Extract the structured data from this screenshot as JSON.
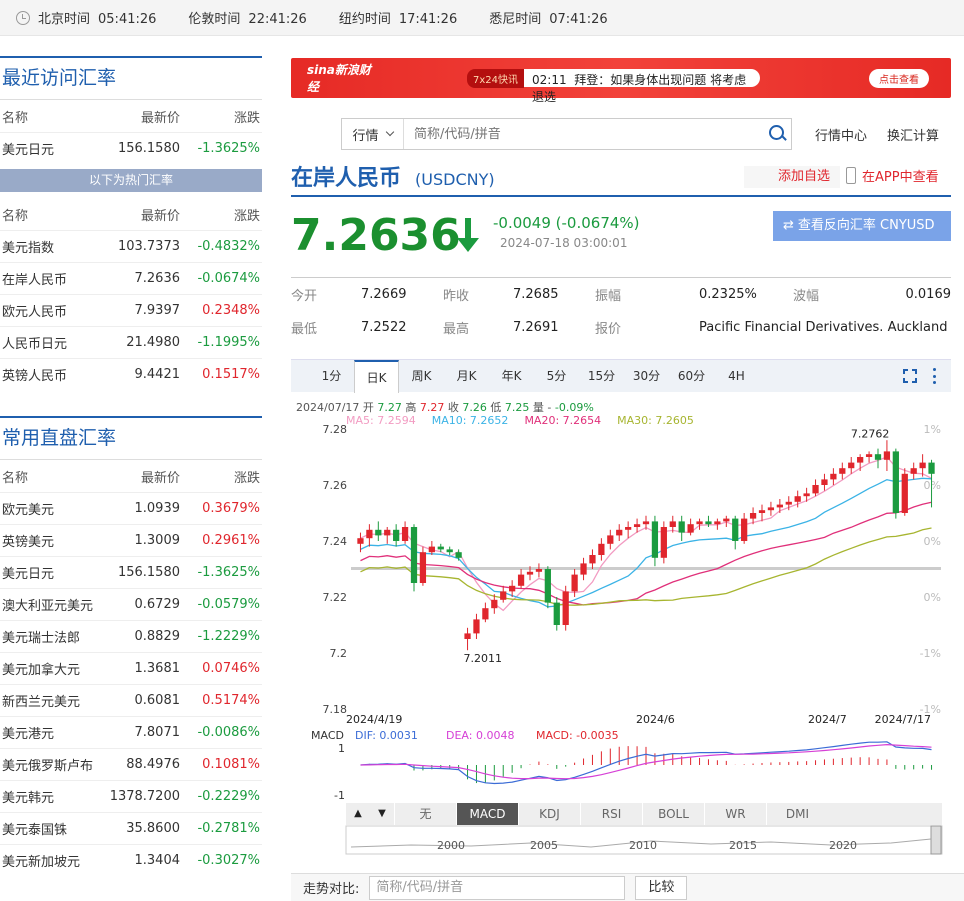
{
  "topbar": {
    "zones": [
      {
        "city": "北京时间",
        "time": "05:41:26"
      },
      {
        "city": "伦敦时间",
        "time": "22:41:26"
      },
      {
        "city": "纽约时间",
        "time": "17:41:26"
      },
      {
        "city": "悉尼时间",
        "time": "07:41:26"
      }
    ]
  },
  "recent": {
    "title": "最近访问汇率",
    "headers": [
      "名称",
      "最新价",
      "涨跌"
    ],
    "rows": [
      {
        "name": "美元日元",
        "price": "156.1580",
        "chg": "-1.3625%",
        "dir": "dn"
      }
    ],
    "hot_label": "以下为热门汇率",
    "hot_rows": [
      {
        "name": "美元指数",
        "price": "103.7373",
        "chg": "-0.4832%",
        "dir": "dn"
      },
      {
        "name": "在岸人民币",
        "price": "7.2636",
        "chg": "-0.0674%",
        "dir": "dn"
      },
      {
        "name": "欧元人民币",
        "price": "7.9397",
        "chg": "0.2348%",
        "dir": "up"
      },
      {
        "name": "人民币日元",
        "price": "21.4980",
        "chg": "-1.1995%",
        "dir": "dn"
      },
      {
        "name": "英镑人民币",
        "price": "9.4421",
        "chg": "0.1517%",
        "dir": "up"
      }
    ]
  },
  "common": {
    "title": "常用直盘汇率",
    "headers": [
      "名称",
      "最新价",
      "涨跌"
    ],
    "rows": [
      {
        "name": "欧元美元",
        "price": "1.0939",
        "chg": "0.3679%",
        "dir": "up"
      },
      {
        "name": "英镑美元",
        "price": "1.3009",
        "chg": "0.2961%",
        "dir": "up"
      },
      {
        "name": "美元日元",
        "price": "156.1580",
        "chg": "-1.3625%",
        "dir": "dn"
      },
      {
        "name": "澳大利亚元美元",
        "price": "0.6729",
        "chg": "-0.0579%",
        "dir": "dn"
      },
      {
        "name": "美元瑞士法郎",
        "price": "0.8829",
        "chg": "-1.2229%",
        "dir": "dn"
      },
      {
        "name": "美元加拿大元",
        "price": "1.3681",
        "chg": "0.0746%",
        "dir": "up"
      },
      {
        "name": "新西兰元美元",
        "price": "0.6081",
        "chg": "0.5174%",
        "dir": "up"
      },
      {
        "name": "美元港元",
        "price": "7.8071",
        "chg": "-0.0086%",
        "dir": "dn"
      },
      {
        "name": "美元俄罗斯卢布",
        "price": "88.4976",
        "chg": "0.1081%",
        "dir": "up"
      },
      {
        "name": "美元韩元",
        "price": "1378.7200",
        "chg": "-0.2229%",
        "dir": "dn"
      },
      {
        "name": "美元泰国铢",
        "price": "35.8600",
        "chg": "-0.2781%",
        "dir": "dn"
      },
      {
        "name": "美元新加坡元",
        "price": "1.3404",
        "chg": "-0.3027%",
        "dir": "dn"
      }
    ]
  },
  "banner": {
    "logo": "sina新浪财经",
    "tag": "7x24快讯",
    "time": "02:11",
    "text": "拜登：如果身体出现问题 将考虑退选",
    "button": "点击查看"
  },
  "search": {
    "select": "行情",
    "placeholder": "简称/代码/拼音"
  },
  "links": {
    "market": "行情中心",
    "calc": "换汇计算"
  },
  "header": {
    "title": "在岸人民币",
    "code": "(USDCNY)",
    "add_fav": "添加自选",
    "app_view": "在APP中查看",
    "price": "7.2636",
    "change": "-0.0049 (-0.0674%)",
    "time": "2024-07-18 03:00:01",
    "reverse_btn": "查看反向汇率 CNYUSD"
  },
  "stats": {
    "row1": [
      {
        "k": "今开",
        "v": "7.2669"
      },
      {
        "k": "昨收",
        "v": "7.2685"
      },
      {
        "k": "振幅",
        "v": "0.2325%"
      },
      {
        "k": "波幅",
        "v": "0.0169"
      }
    ],
    "row2": [
      {
        "k": "最低",
        "v": "7.2522"
      },
      {
        "k": "最高",
        "v": "7.2691"
      },
      {
        "k": "报价",
        "v": "Pacific Financial Derivatives. Auckland"
      }
    ]
  },
  "chart_tabs": [
    "1分",
    "日K",
    "周K",
    "月K",
    "年K",
    "5分",
    "15分",
    "30分",
    "60分",
    "4H"
  ],
  "chart_tab_active": "日K",
  "chart_info": {
    "ohlc": [
      {
        "t": "2024/07/17 开 ",
        "c": "#555"
      },
      {
        "t": "7.27",
        "c": "#1b9b3f"
      },
      {
        "t": " 高 ",
        "c": "#555"
      },
      {
        "t": "7.27",
        "c": "#e0262d"
      },
      {
        "t": " 收 ",
        "c": "#555"
      },
      {
        "t": "7.26",
        "c": "#1b9b3f"
      },
      {
        "t": " 低 ",
        "c": "#555"
      },
      {
        "t": "7.25",
        "c": "#1b9b3f"
      },
      {
        "t": " 量 - ",
        "c": "#555"
      },
      {
        "t": "-0.09%",
        "c": "#1b9b3f"
      }
    ],
    "ma": [
      {
        "t": "MA5: 7.2594",
        "c": "#f29bc2"
      },
      {
        "t": "MA10: 7.2652",
        "c": "#3bb3e6"
      },
      {
        "t": "MA20: 7.2654",
        "c": "#e0307a"
      },
      {
        "t": "MA30: 7.2605",
        "c": "#a7b530"
      }
    ]
  },
  "chart_data": {
    "type": "candlestick",
    "y_ticks": [
      "7.28",
      "7.26",
      "7.24",
      "7.22",
      "7.2",
      "7.18"
    ],
    "y_ticks_right": [
      "1%",
      "0%",
      "0%",
      "0%",
      "-1%",
      "-1%"
    ],
    "x_labels": [
      "2024/4/19",
      "2024/6",
      "2024/7",
      "2024/7/17"
    ],
    "ylim": [
      7.18,
      7.28
    ],
    "annotations": [
      {
        "label": "7.2762",
        "value": 7.2762
      },
      {
        "label": "7.2011",
        "value": 7.2011
      }
    ],
    "candles": [
      [
        7.239,
        7.243,
        7.236,
        7.241
      ],
      [
        7.241,
        7.246,
        7.238,
        7.244
      ],
      [
        7.244,
        7.247,
        7.24,
        7.242
      ],
      [
        7.242,
        7.245,
        7.239,
        7.244
      ],
      [
        7.244,
        7.246,
        7.238,
        7.24
      ],
      [
        7.24,
        7.247,
        7.239,
        7.245
      ],
      [
        7.245,
        7.246,
        7.222,
        7.225
      ],
      [
        7.225,
        7.238,
        7.224,
        7.236
      ],
      [
        7.236,
        7.24,
        7.235,
        7.238
      ],
      [
        7.238,
        7.239,
        7.236,
        7.237
      ],
      [
        7.237,
        7.238,
        7.235,
        7.236
      ],
      [
        7.236,
        7.237,
        7.233,
        7.234
      ],
      [
        7.205,
        7.209,
        7.201,
        7.207
      ],
      [
        7.207,
        7.214,
        7.205,
        7.212
      ],
      [
        7.212,
        7.218,
        7.211,
        7.216
      ],
      [
        7.216,
        7.221,
        7.214,
        7.219
      ],
      [
        7.219,
        7.224,
        7.218,
        7.222
      ],
      [
        7.222,
        7.226,
        7.22,
        7.224
      ],
      [
        7.224,
        7.23,
        7.223,
        7.228
      ],
      [
        7.228,
        7.231,
        7.226,
        7.229
      ],
      [
        7.229,
        7.232,
        7.227,
        7.23
      ],
      [
        7.23,
        7.231,
        7.216,
        7.218
      ],
      [
        7.218,
        7.22,
        7.208,
        7.21
      ],
      [
        7.21,
        7.224,
        7.208,
        7.222
      ],
      [
        7.222,
        7.23,
        7.22,
        7.228
      ],
      [
        7.228,
        7.234,
        7.226,
        7.232
      ],
      [
        7.232,
        7.237,
        7.23,
        7.235
      ],
      [
        7.235,
        7.241,
        7.233,
        7.239
      ],
      [
        7.239,
        7.244,
        7.237,
        7.242
      ],
      [
        7.242,
        7.246,
        7.24,
        7.244
      ],
      [
        7.244,
        7.247,
        7.241,
        7.245
      ],
      [
        7.245,
        7.248,
        7.243,
        7.246
      ],
      [
        7.246,
        7.249,
        7.244,
        7.247
      ],
      [
        7.247,
        7.249,
        7.231,
        7.234
      ],
      [
        7.234,
        7.247,
        7.232,
        7.245
      ],
      [
        7.245,
        7.249,
        7.243,
        7.247
      ],
      [
        7.247,
        7.249,
        7.24,
        7.243
      ],
      [
        7.243,
        7.248,
        7.242,
        7.246
      ],
      [
        7.246,
        7.248,
        7.244,
        7.247
      ],
      [
        7.247,
        7.249,
        7.245,
        7.246
      ],
      [
        7.246,
        7.248,
        7.244,
        7.247
      ],
      [
        7.247,
        7.249,
        7.245,
        7.248
      ],
      [
        7.248,
        7.249,
        7.237,
        7.24
      ],
      [
        7.24,
        7.25,
        7.239,
        7.248
      ],
      [
        7.248,
        7.252,
        7.246,
        7.25
      ],
      [
        7.25,
        7.253,
        7.247,
        7.251
      ],
      [
        7.251,
        7.254,
        7.249,
        7.252
      ],
      [
        7.252,
        7.255,
        7.25,
        7.253
      ],
      [
        7.253,
        7.256,
        7.251,
        7.254
      ],
      [
        7.254,
        7.258,
        7.252,
        7.256
      ],
      [
        7.256,
        7.259,
        7.254,
        7.257
      ],
      [
        7.257,
        7.262,
        7.256,
        7.26
      ],
      [
        7.26,
        7.264,
        7.258,
        7.262
      ],
      [
        7.262,
        7.266,
        7.26,
        7.264
      ],
      [
        7.264,
        7.268,
        7.262,
        7.266
      ],
      [
        7.266,
        7.27,
        7.264,
        7.268
      ],
      [
        7.268,
        7.271,
        7.265,
        7.27
      ],
      [
        7.27,
        7.272,
        7.268,
        7.271
      ],
      [
        7.271,
        7.273,
        7.266,
        7.269
      ],
      [
        7.269,
        7.276,
        7.265,
        7.272
      ],
      [
        7.272,
        7.273,
        7.248,
        7.25
      ],
      [
        7.25,
        7.266,
        7.249,
        7.264
      ],
      [
        7.264,
        7.268,
        7.262,
        7.266
      ],
      [
        7.266,
        7.271,
        7.263,
        7.268
      ],
      [
        7.268,
        7.269,
        7.252,
        7.264
      ]
    ]
  },
  "macd": {
    "label": "MACD",
    "dif": "DIF: 0.0031",
    "dea": "DEA: 0.0048",
    "macd": "MACD: -0.0035",
    "ticks": [
      "1",
      "-1"
    ]
  },
  "indicator_tabs": [
    "无",
    "MACD",
    "KDJ",
    "RSI",
    "BOLL",
    "WR",
    "DMI"
  ],
  "indicator_active": "MACD",
  "overview_years": [
    "2000",
    "2005",
    "2010",
    "2015",
    "2020"
  ],
  "trend": {
    "label": "走势对比:",
    "placeholder": "简称/代码/拼音",
    "button": "比较"
  },
  "colors": {
    "up": "#e0262d",
    "down": "#1b9b3f",
    "accent": "#1f5fae"
  }
}
